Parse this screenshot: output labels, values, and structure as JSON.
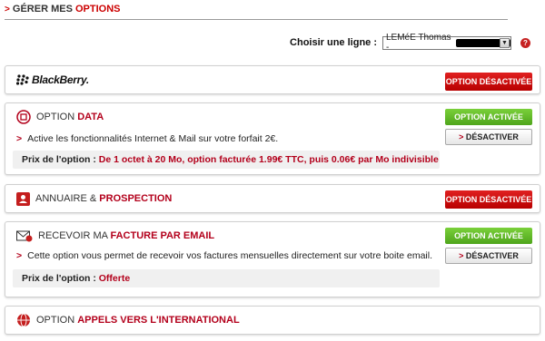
{
  "header": {
    "arrow": ">",
    "title_part1": "GÉRER MES ",
    "title_part2": "OPTIONS"
  },
  "line_selector": {
    "label": "Choisir une ligne :",
    "value": "LEMéE Thomas -",
    "help": "?"
  },
  "panels": {
    "blackberry": {
      "logo_text": "BlackBerry.",
      "button": "OPTION DÉSACTIVÉE"
    },
    "data": {
      "title_plain": "OPTION ",
      "title_bold": "DATA",
      "status_button": "OPTION ACTIVÉE",
      "deactivate_arrow": ">",
      "deactivate_label": "DÉSACTIVER",
      "bullet": ">",
      "description": "Active les fonctionnalités Internet & Mail sur votre forfait 2€.",
      "price_label": "Prix de l'option :",
      "price_value": "De 1 octet à 20 Mo, option facturée 1.99€ TTC, puis 0.06€ par Mo indivisible"
    },
    "annuaire": {
      "title_plain": "ANNUAIRE & ",
      "title_bold": "PROSPECTION",
      "button": "OPTION DÉSACTIVÉE"
    },
    "facture": {
      "title_plain": "RECEVOIR MA ",
      "title_bold": "FACTURE PAR EMAIL",
      "status_button": "OPTION ACTIVÉE",
      "deactivate_arrow": ">",
      "deactivate_label": "DÉSACTIVER",
      "bullet": ">",
      "description": "Cette option vous permet de recevoir vos factures mensuelles directement sur votre boite email.",
      "price_label": "Prix de l'option :",
      "price_value": "Offerte"
    },
    "international": {
      "title_plain": "OPTION ",
      "title_bold": "APPELS VERS L'INTERNATIONAL"
    }
  },
  "colors": {
    "accent_red": "#b3001b",
    "active_green": "#5cb526",
    "inactive_red": "#cc0000"
  },
  "icons": [
    "blackberry-logo-icon",
    "data-icon",
    "directory-icon",
    "email-invoice-icon",
    "globe-icon",
    "help-icon",
    "dropdown-arrow-icon"
  ]
}
